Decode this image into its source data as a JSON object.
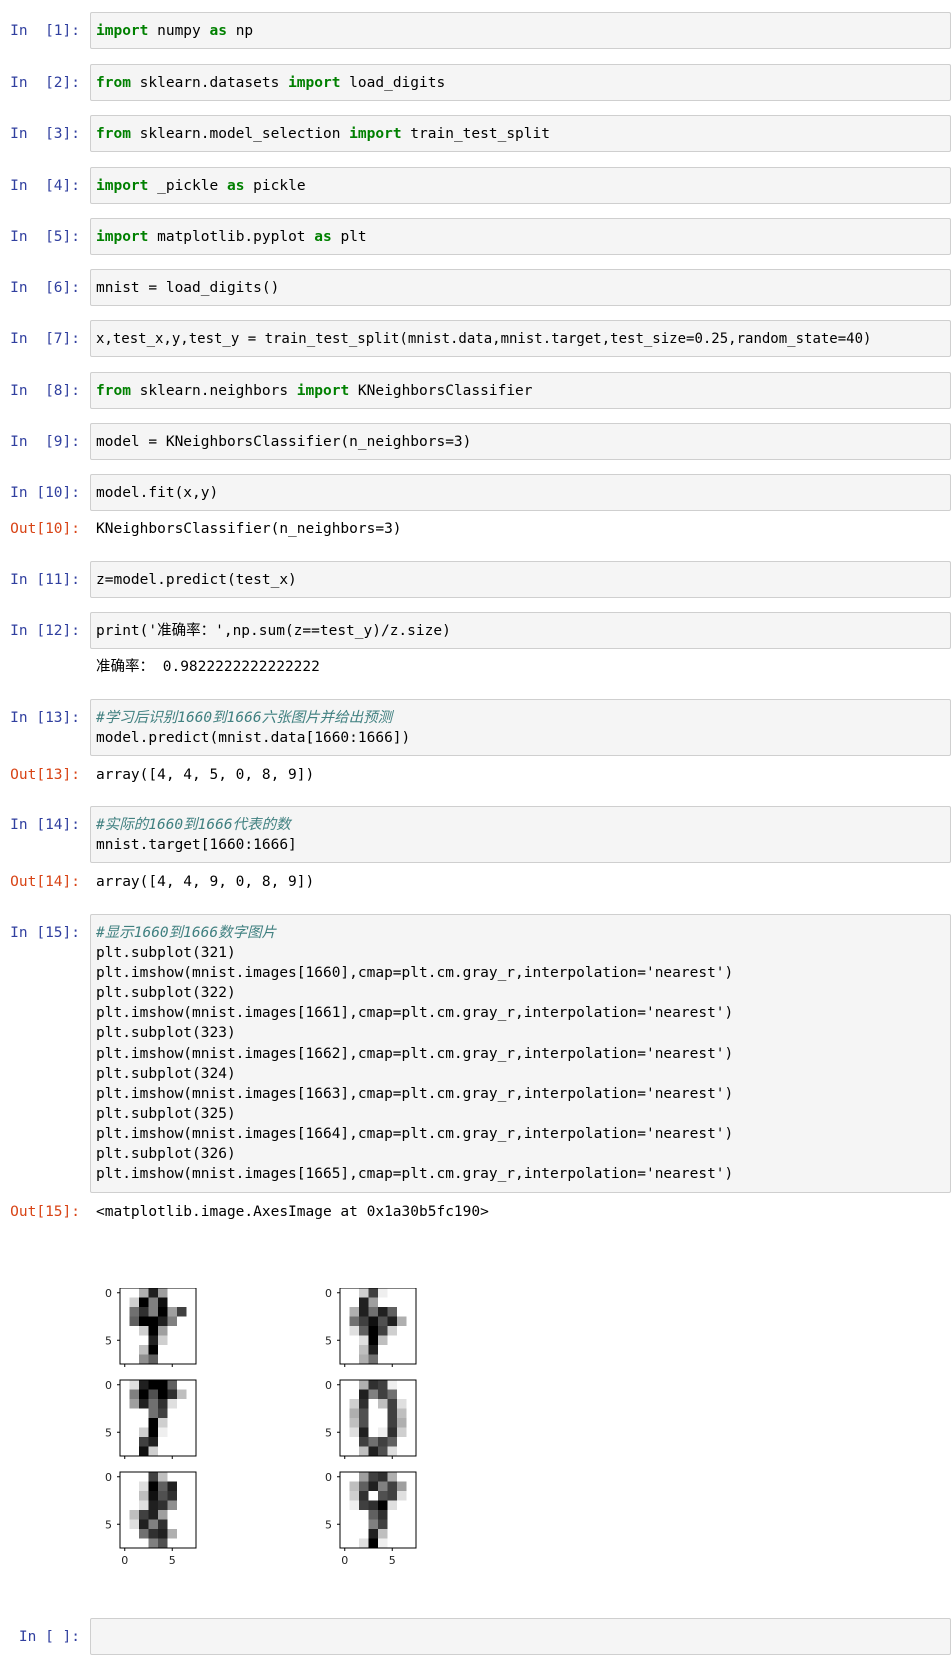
{
  "cells": [
    {
      "prompt": "In  [1]:",
      "out": null
    },
    {
      "prompt": "In  [2]:",
      "out": null
    },
    {
      "prompt": "In  [3]:",
      "out": null
    },
    {
      "prompt": "In  [4]:",
      "out": null
    },
    {
      "prompt": "In  [5]:",
      "out": null
    },
    {
      "prompt": "In  [6]:",
      "out": null
    },
    {
      "prompt": "In  [7]:",
      "out": null
    },
    {
      "prompt": "In  [8]:",
      "out": null
    },
    {
      "prompt": "In  [9]:",
      "out": null
    },
    {
      "prompt": "In [10]:",
      "out_prompt": "Out[10]:",
      "out_text": "KNeighborsClassifier(n_neighbors=3)"
    },
    {
      "prompt": "In [11]:"
    },
    {
      "prompt": "In [12]:",
      "stdout": "准确率： 0.9822222222222222"
    },
    {
      "prompt": "In [13]:",
      "out_prompt": "Out[13]:",
      "out_text": "array([4, 4, 5, 0, 8, 9])"
    },
    {
      "prompt": "In [14]:",
      "out_prompt": "Out[14]:",
      "out_text": "array([4, 4, 9, 0, 8, 9])"
    },
    {
      "prompt": "In [15]:",
      "out_prompt": "Out[15]:",
      "out_text": "<matplotlib.image.AxesImage at 0x1a30b5fc190>"
    },
    {
      "prompt": "In [ ]:"
    }
  ],
  "code": {
    "c1": [
      "import",
      " numpy ",
      "as",
      " np"
    ],
    "c2": [
      "from",
      " sklearn.datasets ",
      "import",
      " load_digits"
    ],
    "c3": [
      "from",
      " sklearn.model_selection ",
      "import",
      " train_test_split"
    ],
    "c4": [
      "import",
      " _pickle ",
      "as",
      " pickle"
    ],
    "c5": [
      "import",
      " matplotlib.pyplot ",
      "as",
      " plt"
    ],
    "c6": "mnist = load_digits()",
    "c7": "x,test_x,y,test_y = train_test_split(mnist.data,mnist.target,test_size=0.25,random_state=40)",
    "c8": [
      "from",
      " sklearn.neighbors ",
      "import",
      " KNeighborsClassifier"
    ],
    "c9": "model = KNeighborsClassifier(n_neighbors=3)",
    "c10": "model.fit(x,y)",
    "c11": "z=model.predict(test_x)",
    "c12": "print('准确率：',np.sum(z==test_y)/z.size)",
    "c13_comment": "#学习后识别1660到1666六张图片并给出预测",
    "c13": "model.predict(mnist.data[1660:1666])",
    "c14_comment": "#实际的1660到1666代表的数",
    "c14": "mnist.target[1660:1666]",
    "c15_comment": "#显示1660到1666数字图片",
    "c15_lines": [
      "plt.subplot(321)",
      "plt.imshow(mnist.images[1660],cmap=plt.cm.gray_r,interpolation='nearest')",
      "plt.subplot(322)",
      "plt.imshow(mnist.images[1661],cmap=plt.cm.gray_r,interpolation='nearest')",
      "plt.subplot(323)",
      "plt.imshow(mnist.images[1662],cmap=plt.cm.gray_r,interpolation='nearest')",
      "plt.subplot(324)",
      "plt.imshow(mnist.images[1663],cmap=plt.cm.gray_r,interpolation='nearest')",
      "plt.subplot(325)",
      "plt.imshow(mnist.images[1664],cmap=plt.cm.gray_r,interpolation='nearest')",
      "plt.subplot(326)",
      "plt.imshow(mnist.images[1665],cmap=plt.cm.gray_r,interpolation='nearest')"
    ]
  },
  "figure": {
    "tick_labels": [
      "0",
      "5"
    ],
    "images": [
      [
        0,
        0,
        5,
        14,
        6,
        0,
        0,
        0,
        0,
        3,
        16,
        8,
        15,
        0,
        0,
        0,
        0,
        9,
        13,
        8,
        16,
        6,
        12,
        0,
        0,
        10,
        16,
        16,
        14,
        8,
        0,
        0,
        0,
        0,
        3,
        16,
        6,
        0,
        0,
        0,
        0,
        0,
        0,
        14,
        3,
        0,
        0,
        0,
        0,
        0,
        4,
        16,
        0,
        0,
        0,
        0,
        0,
        0,
        7,
        10,
        0,
        0,
        0,
        0
      ],
      [
        0,
        0,
        3,
        12,
        1,
        0,
        0,
        0,
        0,
        0,
        14,
        6,
        0,
        0,
        0,
        0,
        0,
        5,
        14,
        9,
        14,
        10,
        0,
        0,
        0,
        9,
        12,
        15,
        11,
        14,
        5,
        0,
        0,
        2,
        10,
        16,
        12,
        3,
        0,
        0,
        0,
        0,
        2,
        16,
        4,
        0,
        0,
        0,
        0,
        0,
        4,
        14,
        0,
        0,
        0,
        0,
        0,
        0,
        5,
        9,
        0,
        0,
        0,
        0
      ],
      [
        0,
        2,
        14,
        16,
        16,
        10,
        0,
        0,
        0,
        8,
        16,
        11,
        16,
        13,
        4,
        0,
        0,
        6,
        14,
        9,
        13,
        2,
        0,
        0,
        0,
        0,
        0,
        9,
        12,
        0,
        0,
        0,
        0,
        0,
        0,
        16,
        3,
        0,
        0,
        0,
        0,
        0,
        3,
        16,
        1,
        0,
        0,
        0,
        0,
        0,
        12,
        14,
        0,
        0,
        0,
        0,
        0,
        0,
        15,
        3,
        0,
        0,
        0,
        0
      ],
      [
        0,
        0,
        5,
        13,
        12,
        1,
        0,
        0,
        0,
        0,
        14,
        8,
        12,
        9,
        0,
        0,
        0,
        3,
        13,
        0,
        4,
        12,
        2,
        0,
        0,
        5,
        11,
        0,
        0,
        12,
        4,
        0,
        0,
        4,
        11,
        0,
        0,
        12,
        5,
        0,
        0,
        2,
        14,
        0,
        1,
        13,
        3,
        0,
        0,
        0,
        12,
        9,
        12,
        10,
        0,
        0,
        0,
        0,
        4,
        14,
        11,
        2,
        0,
        0
      ],
      [
        0,
        0,
        0,
        12,
        4,
        0,
        0,
        0,
        0,
        0,
        2,
        16,
        10,
        14,
        0,
        0,
        0,
        0,
        4,
        15,
        11,
        13,
        0,
        0,
        0,
        0,
        2,
        14,
        13,
        7,
        0,
        0,
        0,
        4,
        12,
        14,
        6,
        0,
        0,
        0,
        0,
        2,
        14,
        8,
        13,
        0,
        0,
        0,
        0,
        0,
        9,
        13,
        14,
        5,
        0,
        0,
        0,
        0,
        0,
        8,
        11,
        0,
        0,
        0
      ],
      [
        0,
        0,
        6,
        12,
        13,
        5,
        0,
        0,
        0,
        4,
        10,
        14,
        8,
        12,
        6,
        0,
        0,
        3,
        13,
        0,
        11,
        12,
        2,
        0,
        0,
        1,
        12,
        13,
        16,
        2,
        0,
        0,
        0,
        0,
        0,
        10,
        13,
        0,
        0,
        0,
        0,
        0,
        0,
        8,
        12,
        0,
        0,
        0,
        0,
        0,
        0,
        14,
        4,
        0,
        0,
        0,
        0,
        0,
        2,
        16,
        1,
        0,
        0,
        0
      ]
    ]
  }
}
